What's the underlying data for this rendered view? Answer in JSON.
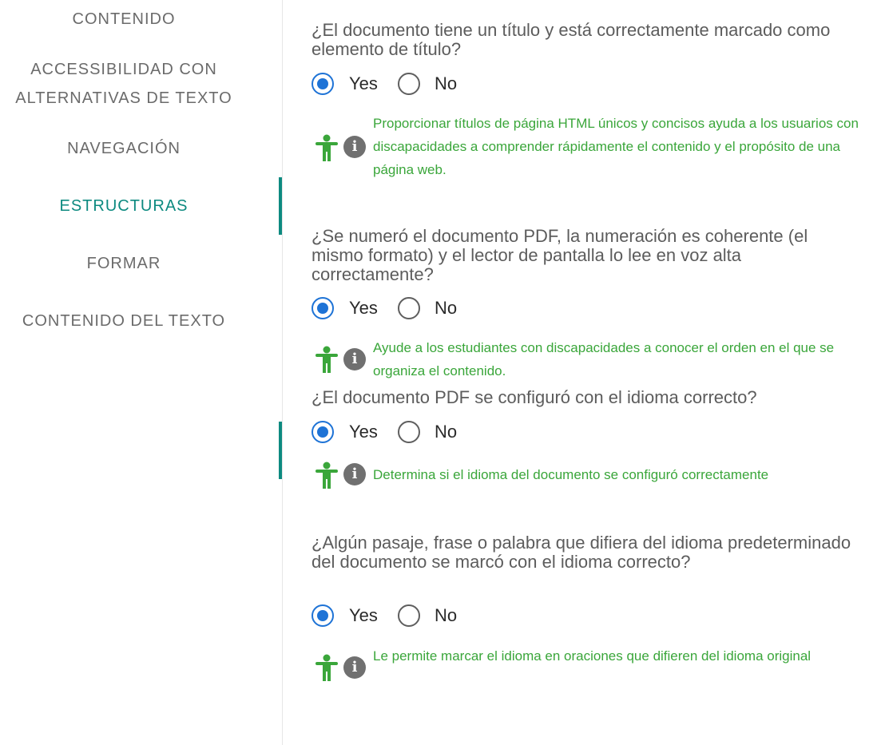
{
  "sidebar": {
    "items": [
      {
        "label": "CONTENIDO"
      },
      {
        "label": "ACCESSIBILIDAD CON ALTERNATIVAS DE TEXTO"
      },
      {
        "label": "NAVEGACIÓN"
      },
      {
        "label": "ESTRUCTURAS"
      },
      {
        "label": "FORMAR"
      },
      {
        "label": "CONTENIDO DEL TEXTO"
      }
    ],
    "active_item": "ESTRUCTURAS",
    "accent_color": "#0d8a80"
  },
  "questions": [
    {
      "text": "¿El documento tiene un título y está correctamente marcado como elemento de título?",
      "options": [
        "Yes",
        "No"
      ],
      "selected": "Yes",
      "tip": "Proporcionar títulos de página HTML únicos y concisos ayuda a los usuarios con discapacidades a comprender rápidamente el contenido y el propósito de una página web."
    },
    {
      "text": "¿Se numeró el documento PDF, la numeración es coherente (el mismo formato) y el lector de pantalla lo lee en voz alta correctamente?",
      "options": [
        "Yes",
        "No"
      ],
      "selected": "Yes",
      "tip": "Ayude a los estudiantes con discapacidades a conocer el orden en el que se organiza el contenido."
    },
    {
      "text": "¿El documento PDF se configuró con el idioma correcto?",
      "options": [
        "Yes",
        "No"
      ],
      "selected": "Yes",
      "tip": "Determina si el idioma del documento se configuró correctamente"
    },
    {
      "text": "¿Algún pasaje, frase o palabra que difiera del idioma predeterminado del documento se marcó con el idioma correcto?",
      "options": [
        "Yes",
        "No"
      ],
      "selected": "Yes",
      "tip": "Le permite marcar el idioma en oraciones que difieren del idioma original"
    }
  ],
  "icons": {
    "accessibility": "accessibility-person-icon",
    "info": "info-icon",
    "info_glyph": "i"
  },
  "colors": {
    "radio_selected": "#1e73d6",
    "tip_text": "#3aa63a",
    "accessibility_icon": "#3aa63a",
    "info_icon": "#707070"
  }
}
